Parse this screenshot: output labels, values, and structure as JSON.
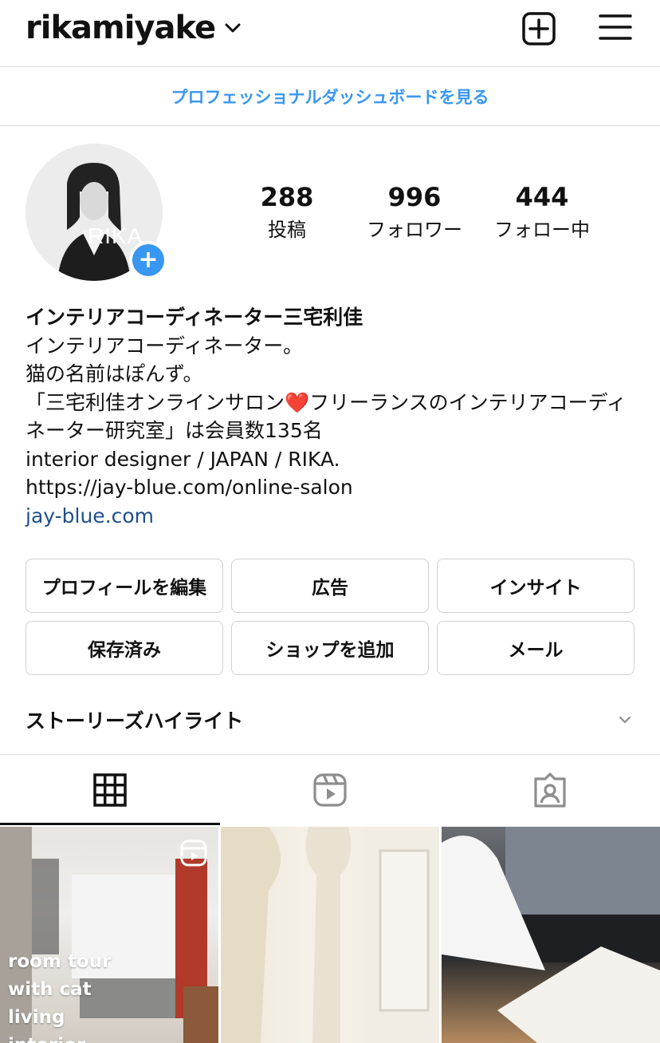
{
  "header": {
    "username": "rikamiyake"
  },
  "dashboard": {
    "label": "プロフェッショナルダッシュボードを見る"
  },
  "profile": {
    "avatar_text": "RIKA",
    "stats": [
      {
        "value": "288",
        "label": "投稿"
      },
      {
        "value": "996",
        "label": "フォロワー"
      },
      {
        "value": "444",
        "label": "フォロー中"
      }
    ]
  },
  "bio": {
    "name": "インテリアコーディネーター三宅利佳",
    "lines": [
      "インテリアコーディネーター。",
      "猫の名前はぽんず。",
      "「三宅利佳オンラインサロン❤️フリーランスのインテリアコーディネーター研究室」は会員数135名",
      "interior designer / JAPAN / RIKA.",
      "https://jay-blue.com/online-salon"
    ],
    "link": "jay-blue.com"
  },
  "buttons": {
    "edit_profile": "プロフィールを編集",
    "ads": "広告",
    "insights": "インサイト",
    "saved": "保存済み",
    "add_shop": "ショップを追加",
    "email": "メール"
  },
  "highlights": {
    "label": "ストーリーズハイライト"
  },
  "tabs": [
    {
      "icon": "grid-icon",
      "active": true
    },
    {
      "icon": "reels-icon",
      "active": false
    },
    {
      "icon": "tagged-icon",
      "active": false
    }
  ],
  "grid": {
    "tile1_caption": "room tour with cat living interior"
  },
  "colors": {
    "accent": "#3897f0",
    "link": "#1f4f8b",
    "border": "#dbdbdb"
  }
}
